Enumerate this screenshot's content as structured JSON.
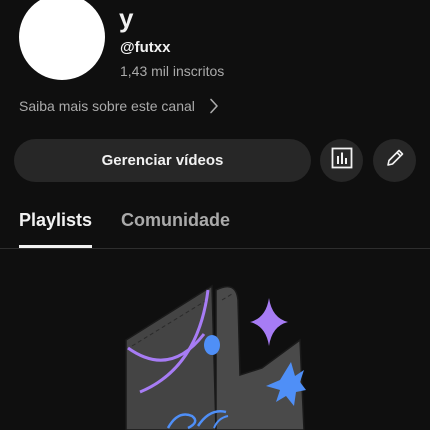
{
  "channel": {
    "name": "y",
    "handle": "@futxx",
    "subscribers": "1,43 mil inscritos",
    "about_link": "Saiba mais sobre este canal"
  },
  "actions": {
    "manage_videos_label": "Gerenciar vídeos",
    "stats_icon": "bar-chart-icon",
    "edit_icon": "pencil-icon"
  },
  "tabs": [
    {
      "label": "Playlists",
      "active": true
    },
    {
      "label": "Comunidade",
      "active": false
    }
  ],
  "colors": {
    "background": "#0f0f0f",
    "button_bg": "#272727",
    "secondary_text": "#aaaaaa",
    "accent_purple": "#a77cf5",
    "accent_blue": "#4f8ff7"
  }
}
